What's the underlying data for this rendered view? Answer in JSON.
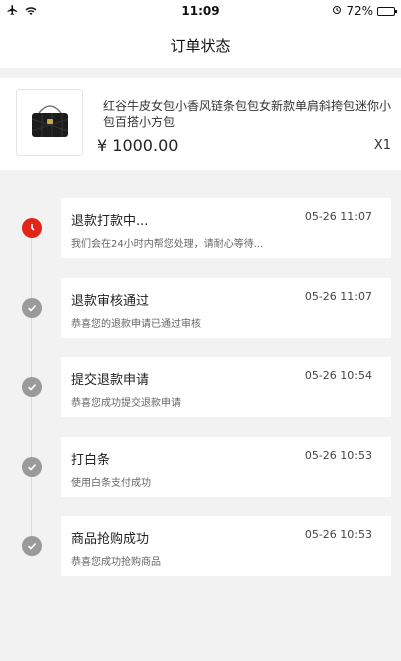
{
  "status_bar": {
    "time": "11:09",
    "battery_text": "72%",
    "battery_level": 0.72,
    "icons": [
      "airplane-icon",
      "wifi-icon",
      "alarm-icon",
      "battery-icon"
    ]
  },
  "nav": {
    "title": "订单状态"
  },
  "product": {
    "title": "红谷牛皮女包小香风链条包包女新款单肩斜挎包迷你小包百搭小方包",
    "price": "¥ 1000.00",
    "quantity": "X1",
    "image_icon": "handbag-icon"
  },
  "timeline": {
    "steps": [
      {
        "title": "退款打款中...",
        "time": "05-26 11:07",
        "desc": "我们会在24小时内帮您处理，请耐心等待...",
        "state": "active",
        "icon": "clock-icon"
      },
      {
        "title": "退款审核通过",
        "time": "05-26 11:07",
        "desc": "恭喜您的退款申请已通过审核",
        "state": "done",
        "icon": "check-icon"
      },
      {
        "title": "提交退款申请",
        "time": "05-26 10:54",
        "desc": "恭喜您成功提交退款申请",
        "state": "done",
        "icon": "check-icon"
      },
      {
        "title": "打白条",
        "time": "05-26 10:53",
        "desc": "使用白条支付成功",
        "state": "done",
        "icon": "check-icon"
      },
      {
        "title": "商品抢购成功",
        "time": "05-26 10:53",
        "desc": "恭喜您成功抢购商品",
        "state": "done",
        "icon": "check-icon"
      }
    ]
  },
  "colors": {
    "accent_red": "#e1251b",
    "done_gray": "#9a9a9a",
    "page_bg": "#f2f2f2"
  }
}
